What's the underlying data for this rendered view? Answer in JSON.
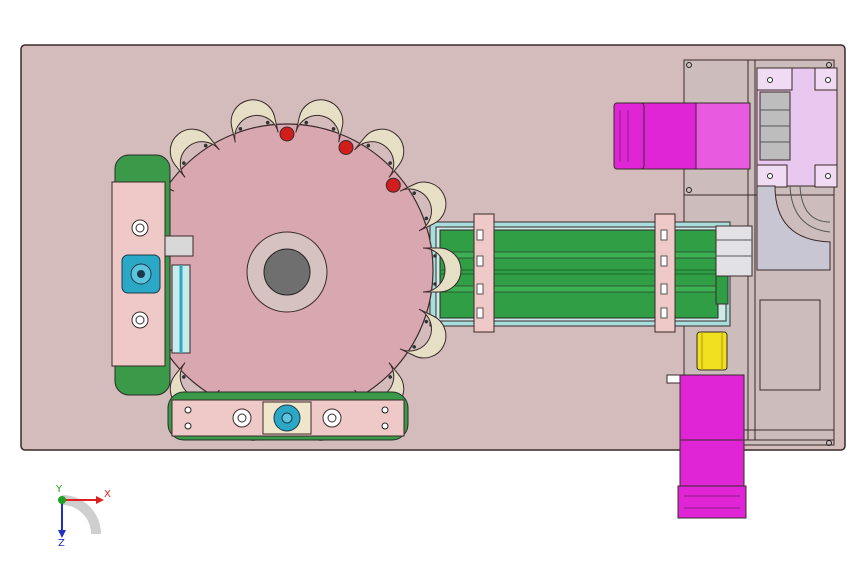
{
  "axis_triad": {
    "x_label": "X",
    "y_label": "Y",
    "z_label": "Z",
    "x_color": "#e02020",
    "y_color": "#20a020",
    "z_color": "#2030c0"
  },
  "colors": {
    "background": "#ffffff",
    "base_plate": "#d4bcbc",
    "turntable": "#d9a7b0",
    "turntable_hub": "#d7c2c2",
    "turntable_bore": "#6f6f6f",
    "pocket_holder": "#e6dfc6",
    "red_pin": "#d21d1d",
    "conveyor_belt": "#2f9e44",
    "conveyor_frame": "#a8dede",
    "clamp": "#efc8c8",
    "motor": "#e025d6",
    "gearbox": "#e8c8ee",
    "frame_plate": "#ccbcbc",
    "coupling": "#f0e020",
    "bearing_cyan": "#2aa8c6",
    "guide_green": "#3b9a4a",
    "outline": "#3a2a2a"
  },
  "icons": {
    "turntable": "star-wheel-icon",
    "motor": "servo-motor-icon",
    "conveyor": "belt-conveyor-icon",
    "bearing": "flange-bearing-icon"
  }
}
